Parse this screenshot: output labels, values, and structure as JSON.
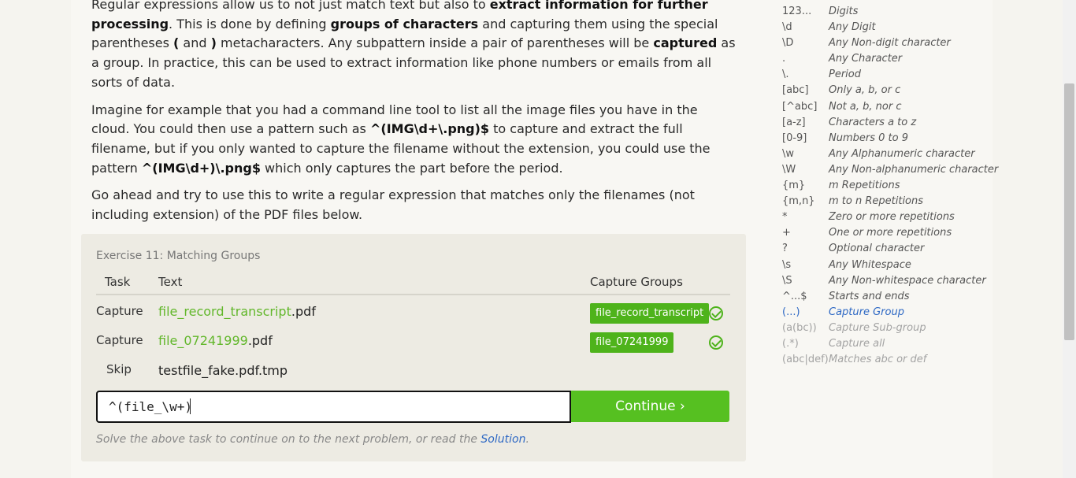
{
  "lesson": {
    "p1": {
      "t1": "Regular expressions allow us to not just match text but also to ",
      "b1": "extract information for further processing",
      "t2": ". This is done by defining ",
      "b2": "groups of characters",
      "t3": " and capturing them using the special parentheses ",
      "b3": "(",
      "t4": " and ",
      "b4": ")",
      "t5": " metacharacters. Any subpattern inside a pair of parentheses will be ",
      "b5": "captured",
      "t6": " as a group. In practice, this can be used to extract information like phone numbers or emails from all sorts of data."
    },
    "p2": {
      "t1": "Imagine for example that you had a command line tool to list all the image files you have in the cloud. You could then use a pattern such as ",
      "b1": "^(IMG\\d+\\.png)$",
      "t2": " to capture and extract the full filename, but if you only wanted to capture the filename without the extension, you could use the pattern ",
      "b2": "^(IMG\\d+)\\.png$",
      "t3": " which only captures the part before the period."
    },
    "p3": "Go ahead and try to use this to write a regular expression that matches only the filenames (not including extension) of the PDF files below."
  },
  "exercise": {
    "title": "Exercise 11: Matching Groups",
    "headers": {
      "task": "Task",
      "text": "Text",
      "groups": "Capture Groups"
    },
    "rows": [
      {
        "task": "Capture",
        "match": "file_record_transcript",
        "rest": ".pdf",
        "group": "file_record_transcript"
      },
      {
        "task": "Capture",
        "match": "file_07241999",
        "rest": ".pdf",
        "group": "file_07241999"
      },
      {
        "task": "Skip",
        "match": "",
        "rest": "testfile_fake.pdf.tmp",
        "group": ""
      }
    ],
    "input_value": "^(file_\\w+)",
    "continue_label": "Continue ›",
    "hint_before": "Solve the above task to continue on to the next problem, or read the ",
    "hint_link": "Solution",
    "hint_after": "."
  },
  "sidebar": [
    {
      "key": "123...",
      "desc": "Digits"
    },
    {
      "key": "\\d",
      "desc": "Any Digit"
    },
    {
      "key": "\\D",
      "desc": "Any Non-digit character"
    },
    {
      "key": ".",
      "desc": "Any Character"
    },
    {
      "key": "\\.",
      "desc": "Period"
    },
    {
      "key": "[abc]",
      "desc": "Only a, b, or c"
    },
    {
      "key": "[^abc]",
      "desc": "Not a, b, nor c"
    },
    {
      "key": "[a-z]",
      "desc": "Characters a to z"
    },
    {
      "key": "[0-9]",
      "desc": "Numbers 0 to 9"
    },
    {
      "key": "\\w",
      "desc": "Any Alphanumeric character"
    },
    {
      "key": "\\W",
      "desc": "Any Non-alphanumeric character"
    },
    {
      "key": "{m}",
      "desc": "m Repetitions"
    },
    {
      "key": "{m,n}",
      "desc": "m to n Repetitions"
    },
    {
      "key": "*",
      "desc": "Zero or more repetitions"
    },
    {
      "key": "+",
      "desc": "One or more repetitions"
    },
    {
      "key": "?",
      "desc": "Optional character"
    },
    {
      "key": "\\s",
      "desc": "Any Whitespace"
    },
    {
      "key": "\\S",
      "desc": "Any Non-whitespace character"
    },
    {
      "key": "^...$",
      "desc": "Starts and ends"
    },
    {
      "key": "(...)",
      "desc": "Capture Group"
    },
    {
      "key": "(a(bc))",
      "desc": "Capture Sub-group"
    },
    {
      "key": "(.*)",
      "desc": "Capture all"
    },
    {
      "key": "(abc|def)",
      "desc": "Matches abc or def"
    }
  ],
  "colors": {
    "accent_green": "#56c021",
    "match_green": "#62b72b",
    "link_blue": "#2d68c4"
  }
}
